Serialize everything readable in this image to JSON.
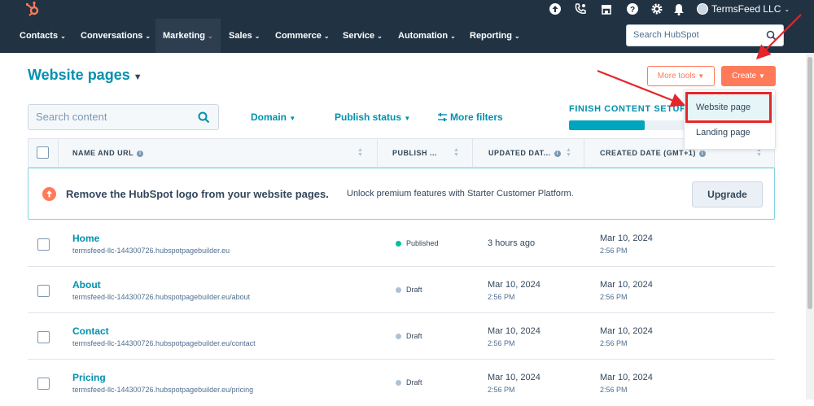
{
  "topbar": {
    "account_name": "TermsFeed LLC",
    "icons": [
      "hubspot-logo",
      "upgrade-icon",
      "calling-icon",
      "marketplace-icon",
      "help-icon",
      "settings-icon",
      "notifications-icon"
    ]
  },
  "nav": {
    "items": [
      {
        "label": "Contacts"
      },
      {
        "label": "Conversations"
      },
      {
        "label": "Marketing"
      },
      {
        "label": "Sales"
      },
      {
        "label": "Commerce"
      },
      {
        "label": "Service"
      },
      {
        "label": "Automation"
      },
      {
        "label": "Reporting"
      }
    ],
    "active": "Marketing",
    "search_placeholder": "Search HubSpot"
  },
  "header": {
    "title": "Website pages",
    "more_tools_label": "More tools",
    "create_label": "Create"
  },
  "create_menu": {
    "items": [
      "Website page",
      "Landing page"
    ],
    "highlighted": "Website page"
  },
  "filters": {
    "search_placeholder": "Search content",
    "domain_label": "Domain",
    "publish_status_label": "Publish status",
    "more_filters_label": "More filters",
    "finish_setup_label": "FINISH CONTENT SETUP",
    "setup_progress": 0.64
  },
  "table": {
    "columns": [
      "NAME AND URL",
      "PUBLISH ...",
      "UPDATED DAT...",
      "CREATED DATE (GMT+1)"
    ],
    "banner": {
      "title": "Remove the HubSpot logo from your website pages.",
      "text": "Unlock premium features with Starter Customer Platform.",
      "button": "Upgrade"
    },
    "rows": [
      {
        "name": "Home",
        "url": "termsfeed-llc-144300726.hubspotpagebuilder.eu",
        "status": "Published",
        "updated": "3 hours ago",
        "updated_time": "",
        "created": "Mar 10, 2024",
        "created_time": "2:56 PM"
      },
      {
        "name": "About",
        "url": "termsfeed-llc-144300726.hubspotpagebuilder.eu/about",
        "status": "Draft",
        "updated": "Mar 10, 2024",
        "updated_time": "2:56 PM",
        "created": "Mar 10, 2024",
        "created_time": "2:56 PM"
      },
      {
        "name": "Contact",
        "url": "termsfeed-llc-144300726.hubspotpagebuilder.eu/contact",
        "status": "Draft",
        "updated": "Mar 10, 2024",
        "updated_time": "2:56 PM",
        "created": "Mar 10, 2024",
        "created_time": "2:56 PM"
      },
      {
        "name": "Pricing",
        "url": "termsfeed-llc-144300726.hubspotpagebuilder.eu/pricing",
        "status": "Draft",
        "updated": "Mar 10, 2024",
        "updated_time": "2:56 PM",
        "created": "Mar 10, 2024",
        "created_time": "2:56 PM"
      }
    ]
  },
  "colors": {
    "brand_orange": "#ff7a59",
    "teal": "#0091ae",
    "nav_bg": "#213343",
    "published": "#00bda5",
    "draft": "#b0c1d4",
    "annotation_red": "#e4262a"
  }
}
